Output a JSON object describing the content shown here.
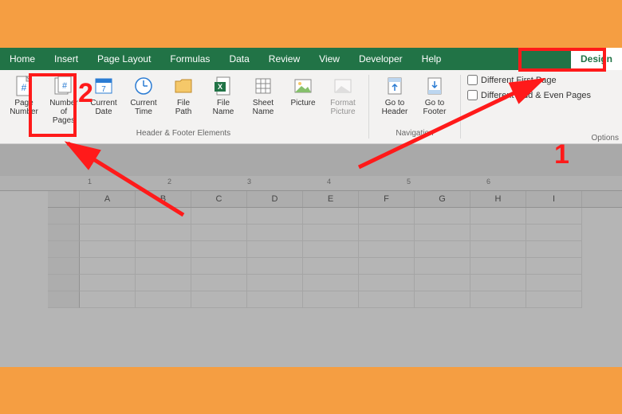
{
  "tabs": [
    "Home",
    "Insert",
    "Page Layout",
    "Formulas",
    "Data",
    "Review",
    "View",
    "Developer",
    "Help",
    "Design"
  ],
  "activeTab": 9,
  "groups": {
    "hfElements": {
      "label": "Header & Footer Elements",
      "buttons": [
        {
          "label": "Page\nNumber",
          "icon": "#"
        },
        {
          "label": "Number of\nPages",
          "icon": "#"
        },
        {
          "label": "Current\nDate",
          "icon": "7"
        },
        {
          "label": "Current\nTime",
          "icon": "◷"
        },
        {
          "label": "File\nPath",
          "icon": "📂"
        },
        {
          "label": "File\nName",
          "icon": "x"
        },
        {
          "label": "Sheet\nName",
          "icon": "▦"
        },
        {
          "label": "Picture",
          "icon": "▧"
        },
        {
          "label": "Format\nPicture",
          "icon": "▣"
        }
      ]
    },
    "navigation": {
      "label": "Navigation",
      "buttons": [
        {
          "label": "Go to\nHeader",
          "icon": "▤"
        },
        {
          "label": "Go to\nFooter",
          "icon": "▤"
        }
      ]
    },
    "options": {
      "label": "Options",
      "checks": [
        {
          "label": "Different First Page"
        },
        {
          "label": "Different Odd & Even Pages"
        }
      ]
    }
  },
  "columns": [
    "",
    "A",
    "B",
    "C",
    "D",
    "E",
    "F",
    "G",
    "H",
    "I"
  ],
  "rulerMarks": [
    "1",
    "2",
    "3",
    "4",
    "5",
    "6"
  ],
  "callouts": {
    "one": "1",
    "two": "2"
  }
}
